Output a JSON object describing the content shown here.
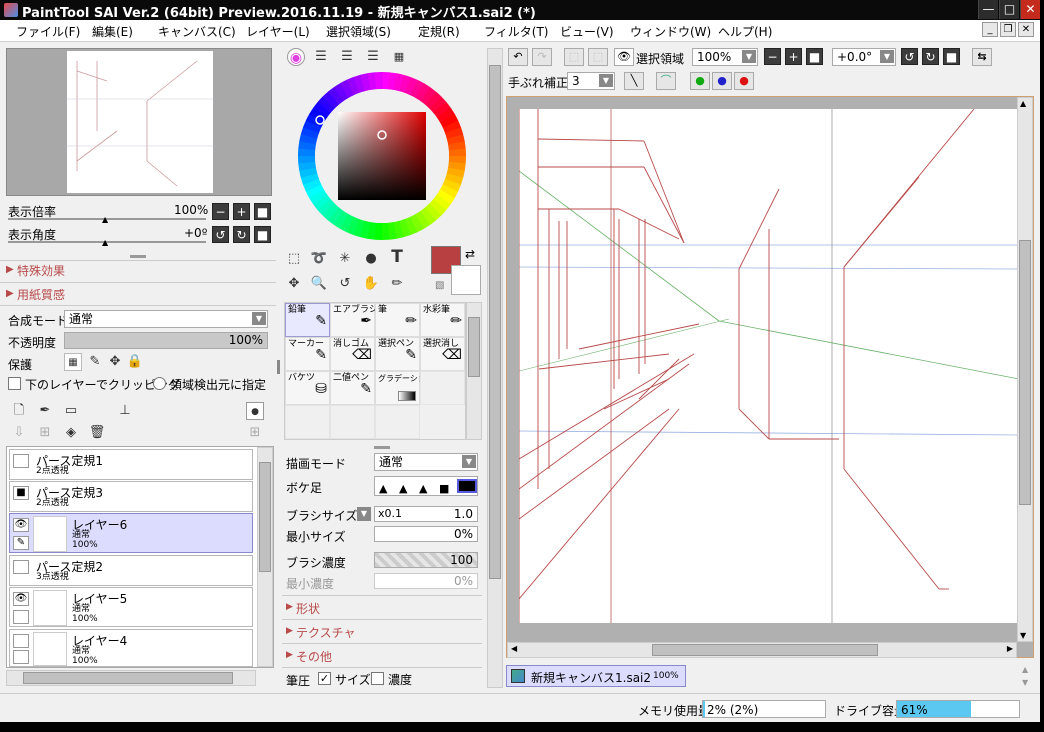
{
  "app": {
    "title": "PaintTool SAI Ver.2 (64bit) Preview.2016.11.19 - 新規キャンバス1.sai2 (*)"
  },
  "menu": [
    "ファイル(F)",
    "編集(E)",
    "キャンバス(C)",
    "レイヤー(L)",
    "選択領域(S)",
    "定規(R)",
    "フィルタ(T)",
    "ビュー(V)",
    "ウィンドウ(W)",
    "ヘルプ(H)"
  ],
  "navigator": {
    "zoom_label": "表示倍率",
    "zoom_value": "100%",
    "angle_label": "表示角度",
    "angle_value": "+0º"
  },
  "sections": {
    "special_effects": "特殊効果",
    "paper_texture": "用紙質感"
  },
  "layer_props": {
    "blend_label": "合成モード",
    "blend_value": "通常",
    "opacity_label": "不透明度",
    "opacity_value": "100%",
    "opacity_level": 1.0,
    "protect_label": "保護",
    "clip_label": "下のレイヤーでクリッピング",
    "region_label": "領域検出元に指定"
  },
  "layers": [
    {
      "name": "パース定規1",
      "sub1": "2点透視",
      "sub2": "",
      "type": "ruler",
      "visible": false,
      "selected": false
    },
    {
      "name": "パース定規3",
      "sub1": "2点透視",
      "sub2": "",
      "type": "ruler",
      "visible": true,
      "selected": false
    },
    {
      "name": "レイヤー6",
      "sub1": "通常",
      "sub2": "100%",
      "type": "layer",
      "visible": true,
      "selected": true
    },
    {
      "name": "パース定規2",
      "sub1": "3点透視",
      "sub2": "",
      "type": "ruler",
      "visible": false,
      "selected": false
    },
    {
      "name": "レイヤー5",
      "sub1": "通常",
      "sub2": "100%",
      "type": "layer",
      "visible": true,
      "selected": false
    },
    {
      "name": "レイヤー4",
      "sub1": "通常",
      "sub2": "100%",
      "type": "layer",
      "visible": false,
      "selected": false
    }
  ],
  "colors": {
    "main": "#b84040",
    "sub": "#ffffff",
    "accent": "#b84a4a"
  },
  "tools": [
    {
      "label": "鉛筆",
      "selected": true
    },
    {
      "label": "エアブラシ",
      "selected": false
    },
    {
      "label": "筆",
      "selected": false
    },
    {
      "label": "水彩筆",
      "selected": false
    },
    {
      "label": "マーカー",
      "selected": false
    },
    {
      "label": "消しゴム",
      "selected": false
    },
    {
      "label": "選択ペン",
      "selected": false
    },
    {
      "label": "選択消し",
      "selected": false
    },
    {
      "label": "バケツ",
      "selected": false
    },
    {
      "label": "二値ペン",
      "selected": false
    },
    {
      "label": "グラデーション",
      "selected": false
    }
  ],
  "brush": {
    "draw_mode_label": "描画モード",
    "draw_mode_value": "通常",
    "blur_label": "ボケ足",
    "size_label": "ブラシサイズ",
    "size_mult": "x0.1",
    "size_value": "1.0",
    "min_size_label": "最小サイズ",
    "min_size_value": "0%",
    "density_label": "ブラシ濃度",
    "density_value": "100",
    "min_density_label": "最小濃度",
    "min_density_value": "0%",
    "shape_label": "形状",
    "texture_label": "テクスチャ",
    "other_label": "その他",
    "pressure_label": "筆圧",
    "pressure_size": "サイズ",
    "pressure_density": "濃度"
  },
  "toolbar": {
    "selection_label": "選択領域",
    "zoom_value": "100%",
    "angle_value": "+0.0°",
    "stabilizer_label": "手ぶれ補正",
    "stabilizer_value": "3"
  },
  "canvas_tab": {
    "name": "新規キャンバス1.sai2",
    "zoom": "100%"
  },
  "status": {
    "memory_label": "メモリ使用量",
    "memory_value": "2% (2%)",
    "memory_level": 0.02,
    "drive_label": "ドライブ容量",
    "drive_value": "61%",
    "drive_level": 0.61
  }
}
